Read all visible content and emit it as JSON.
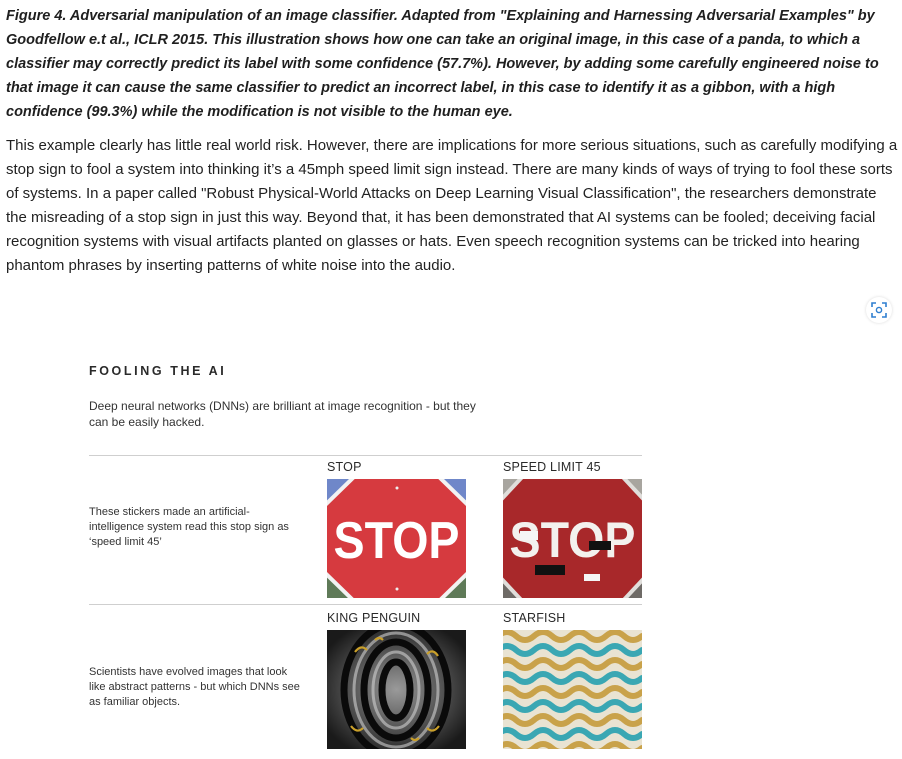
{
  "caption": "Figure 4. Adversarial manipulation of an image classifier. Adapted from \"Explaining and Harnessing Adversarial Examples\" by Goodfellow e.t al., ICLR 2015. This illustration shows how one can take an original image, in this case of a panda, to which a classifier may correctly predict its label with some confidence (57.7%). However, by adding some carefully engineered noise to that image it can cause the same classifier to predict an incorrect label, in this case to identify it as a gibbon, with a high confidence (99.3%) while the modification is not visible to the human eye.",
  "body_text": "This example clearly has little real world risk. However, there are implications for more serious situations, such as carefully modifying a stop sign to fool a system into thinking it’s a 45mph speed limit sign instead. There are many kinds of ways of trying to fool these sorts of systems. In a paper called \"Robust Physical-World Attacks on Deep Learning Visual Classification\", the researchers demonstrate the misreading of a stop sign in just this way. Beyond that, it has been demonstrated that AI systems can be fooled; deceiving facial recognition systems with visual artifacts planted on glasses or hats. Even speech recognition systems can be tricked into hearing phantom phrases by inserting patterns of white noise into the audio.",
  "icons": {
    "scan": "scan-icon"
  },
  "infographic": {
    "title": "FOOLING THE AI",
    "subtitle": "Deep neural networks (DNNs) are brilliant at image recognition - but they can be easily hacked.",
    "rows": [
      {
        "description": "These stickers made an artificial-intelligence system read this stop sign as ‘speed limit 45’",
        "left_label": "STOP",
        "right_label": "SPEED LIMIT 45",
        "left_sign_text": "STOP",
        "right_sign_text": "STOP"
      },
      {
        "description": "Scientists have evolved images that look like abstract patterns - but which DNNs see as familiar objects.",
        "left_label": "KING PENGUIN",
        "right_label": "STARFISH"
      }
    ]
  },
  "colors": {
    "stop_red": "#d63a3f",
    "faded_red": "#a8282a",
    "sky_blue": "#6f87c9",
    "teal": "#3aa7b3",
    "gold": "#c9a24a"
  }
}
